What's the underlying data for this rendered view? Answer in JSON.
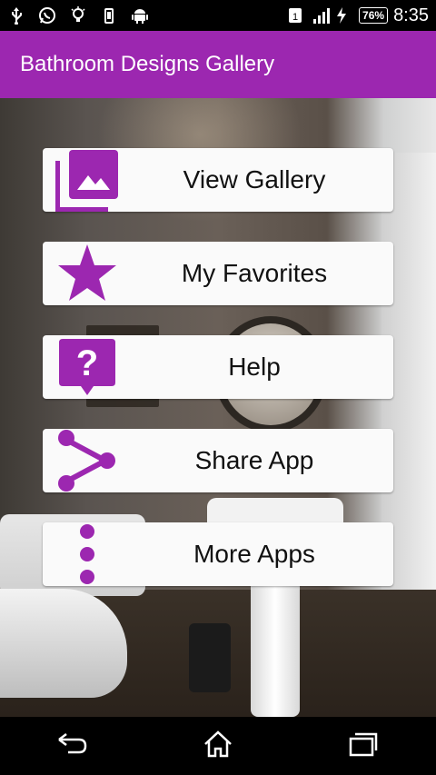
{
  "status_bar": {
    "icons": [
      "usb-icon",
      "whatsapp-icon",
      "bulb-icon",
      "phone-icon",
      "android-icon",
      "sim-icon",
      "signal-icon",
      "charging-icon"
    ],
    "battery": "76%",
    "time": "8:35"
  },
  "app_bar": {
    "title": "Bathroom Designs Gallery",
    "color": "#9c27b0"
  },
  "menu": {
    "items": [
      {
        "label": "View Gallery",
        "icon": "gallery-icon"
      },
      {
        "label": "My Favorites",
        "icon": "star-icon"
      },
      {
        "label": "Help",
        "icon": "help-icon"
      },
      {
        "label": "Share App",
        "icon": "share-icon"
      },
      {
        "label": "More Apps",
        "icon": "more-vert-icon"
      }
    ],
    "icon_color": "#9c27b0"
  },
  "nav_bar": {
    "buttons": [
      "back-icon",
      "home-icon",
      "recents-icon"
    ]
  }
}
